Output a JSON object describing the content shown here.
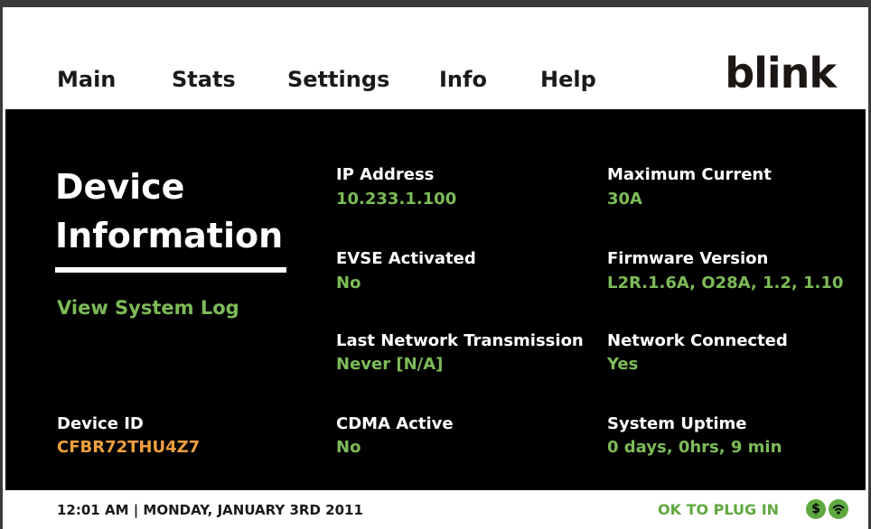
{
  "nav": {
    "tabs": [
      {
        "label": "Main"
      },
      {
        "label": "Stats"
      },
      {
        "label": "Settings",
        "active": true
      },
      {
        "label": "Info"
      },
      {
        "label": "Help"
      }
    ],
    "logo": "blink"
  },
  "sidebar": {
    "title_line1": "Device",
    "title_line2": "Information",
    "system_log_link": "View System Log",
    "device_id_label": "Device ID",
    "device_id_value": "CFBR72THU4Z7"
  },
  "fields": {
    "ip_address": {
      "label": "IP Address",
      "value": "10.233.1.100"
    },
    "evse_activated": {
      "label": "EVSE Activated",
      "value": "No"
    },
    "last_network_transmission": {
      "label": "Last Network Transmission",
      "value": "Never [N/A]"
    },
    "cdma_active": {
      "label": "CDMA Active",
      "value": "No"
    },
    "maximum_current": {
      "label": "Maximum Current",
      "value": "30A"
    },
    "firmware_version": {
      "label": "Firmware Version",
      "value": "L2R.1.6A, O28A, 1.2, 1.10"
    },
    "network_connected": {
      "label": "Network Connected",
      "value": "Yes"
    },
    "system_uptime": {
      "label": "System Uptime",
      "value": "0 days, 0hrs, 9 min"
    }
  },
  "status_bar": {
    "datetime": "12:01 AM | MONDAY, JANUARY 3RD 2011",
    "plug_status": "OK TO PLUG IN",
    "icons": [
      "dollar-icon",
      "wireless-signal-icon"
    ],
    "dollar_glyph": "$"
  },
  "colors": {
    "value_green": "#7dbb58",
    "device_id_orange": "#f0a040",
    "status_green": "#5fa83f",
    "panel_bg": "#000000"
  }
}
